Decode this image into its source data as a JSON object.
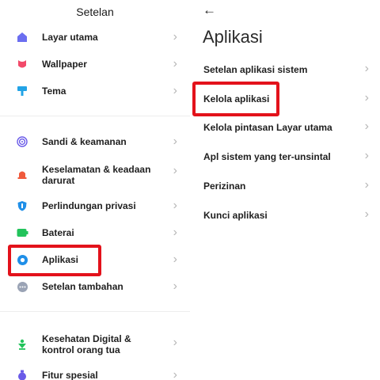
{
  "left": {
    "title": "Setelan",
    "group1": [
      {
        "label": "Layar utama",
        "icon": "home-icon",
        "color": "#6b6ef0"
      },
      {
        "label": "Wallpaper",
        "icon": "flower-icon",
        "color": "#f24a6a"
      },
      {
        "label": "Tema",
        "icon": "brush-icon",
        "color": "#22a3e6"
      }
    ],
    "group2": [
      {
        "label": "Sandi & keamanan",
        "icon": "fingerprint-icon",
        "color": "#6a5be8"
      },
      {
        "label": "Keselamatan & keadaan darurat",
        "icon": "alarm-icon",
        "color": "#f05a3c"
      },
      {
        "label": "Perlindungan privasi",
        "icon": "privacy-shield-icon",
        "color": "#1f8fe8"
      },
      {
        "label": "Baterai",
        "icon": "battery-icon",
        "color": "#22c35b"
      },
      {
        "label": "Aplikasi",
        "icon": "gear-icon",
        "color": "#1f8fe8"
      },
      {
        "label": "Setelan tambahan",
        "icon": "more-dots-icon",
        "color": "#9aa3b5"
      }
    ],
    "group3": [
      {
        "label": "Kesehatan Digital & kontrol orang tua",
        "icon": "wellbeing-icon",
        "color": "#22c35b"
      },
      {
        "label": "Fitur spesial",
        "icon": "medal-icon",
        "color": "#6a5be8"
      }
    ]
  },
  "right": {
    "back_icon": "arrow-left-icon",
    "title": "Aplikasi",
    "items": [
      {
        "label": "Setelan aplikasi sistem"
      },
      {
        "label": "Kelola aplikasi"
      },
      {
        "label": "Kelola pintasan Layar utama"
      },
      {
        "label": "Apl sistem yang ter-unsintal"
      },
      {
        "label": "Perizinan"
      },
      {
        "label": "Kunci aplikasi"
      }
    ]
  },
  "chevron": "›",
  "highlight_color": "#e3121b"
}
